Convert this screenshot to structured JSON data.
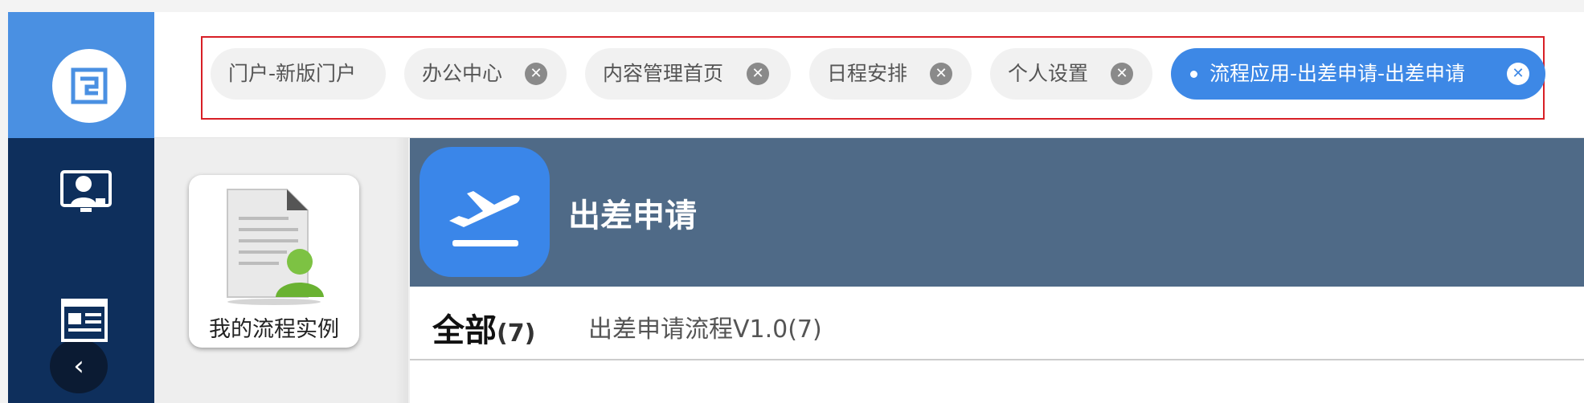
{
  "colors": {
    "rail_top": "#4a90e2",
    "rail": "#0e2f5c",
    "active_tab": "#3d88e6",
    "header_bg": "#4f6a87",
    "app_icon_bg": "#3a86e9",
    "highlight_frame": "#d81f26"
  },
  "rail": {
    "logo_icon": "logo-icon",
    "items": [
      {
        "icon": "user-monitor-icon"
      },
      {
        "icon": "news-icon"
      }
    ],
    "collapse_glyph": "‹"
  },
  "tabs": {
    "items": [
      {
        "label": "门户-新版门户",
        "closable": false
      },
      {
        "label": "办公中心",
        "closable": true
      },
      {
        "label": "内容管理首页",
        "closable": true
      },
      {
        "label": "日程安排",
        "closable": true
      },
      {
        "label": "个人设置",
        "closable": true
      },
      {
        "label": "流程应用-出差申请-出差申请",
        "closable": true,
        "active": true
      }
    ],
    "close_glyph": "✕"
  },
  "sidepanel": {
    "card_label": "我的流程实例",
    "card_icon": "document-user-icon"
  },
  "header": {
    "icon": "airplane-takeoff-icon",
    "title": "出差申请"
  },
  "filters": {
    "all_label": "全部",
    "all_count": "(7)",
    "items": [
      {
        "label": "出差申请流程V1.0(7)"
      }
    ]
  }
}
